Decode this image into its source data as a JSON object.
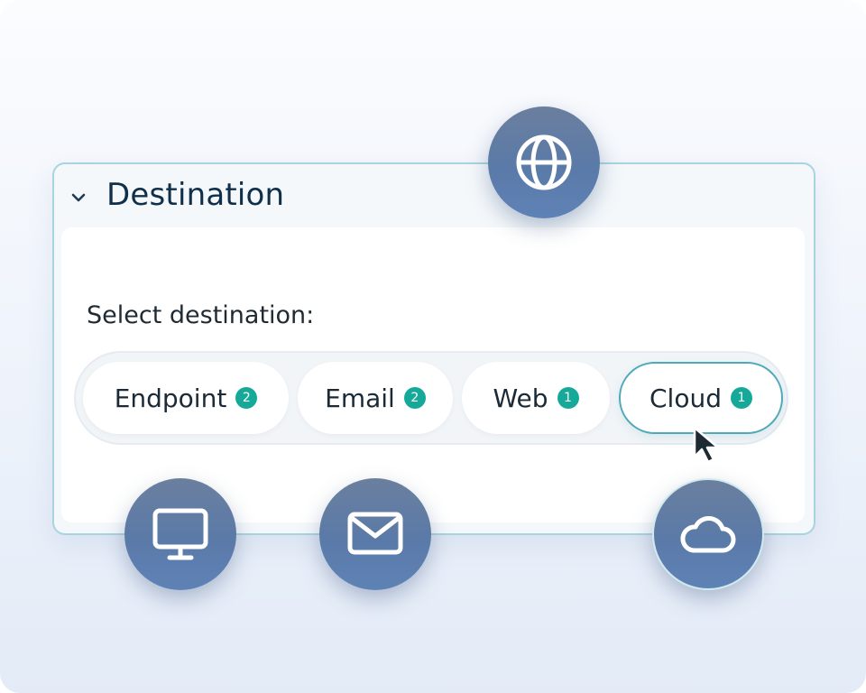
{
  "panel": {
    "title": "Destination",
    "prompt": "Select destination:"
  },
  "segments": [
    {
      "label": "Endpoint",
      "count": "2"
    },
    {
      "label": "Email",
      "count": "2"
    },
    {
      "label": "Web",
      "count": "1"
    },
    {
      "label": "Cloud",
      "count": "1"
    }
  ],
  "selected_segment": "Cloud",
  "icons": {
    "header_toggle": "chevron-down-icon",
    "web": "globe-icon",
    "endpoint": "monitor-icon",
    "email": "envelope-icon",
    "cloud": "cloud-icon",
    "pointer": "mouse-pointer-icon"
  },
  "colors": {
    "accent_border": "#4fa9b9",
    "badge": "#16a99a",
    "circle": "#5f82b6",
    "title": "#0f2f4a"
  }
}
